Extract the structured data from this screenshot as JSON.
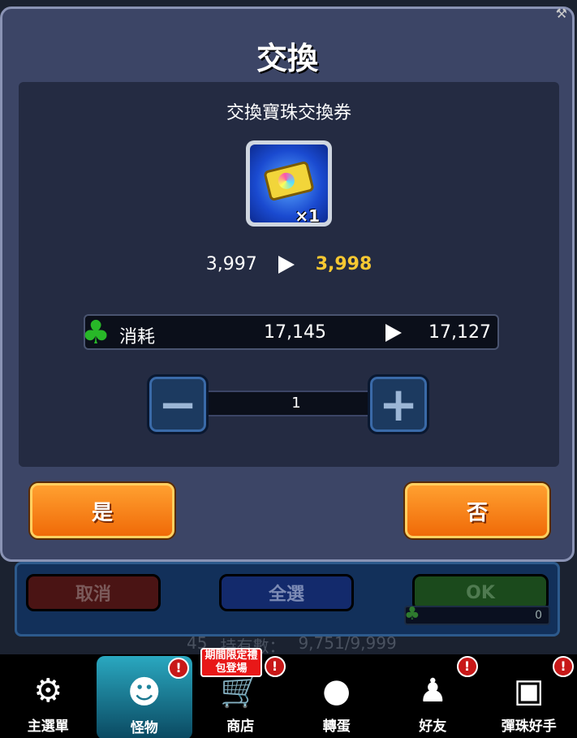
{
  "modal": {
    "title": "交換",
    "subtitle": "交換寶珠交換券",
    "item": {
      "icon": "ticket-icon",
      "quantity": "×1"
    },
    "orbs": {
      "current": "3,997",
      "after": "3,998"
    },
    "cost": {
      "icon": "clover-icon",
      "label": "消耗",
      "current": "17,145",
      "after": "17,127"
    },
    "stepper": {
      "value": "1",
      "minus_icon": "minus-icon",
      "plus_icon": "plus-icon"
    },
    "buttons": {
      "yes": "是",
      "no": "否"
    }
  },
  "background": {
    "cancel": "取消",
    "select_all": "全選",
    "ok": "OK",
    "counter": "0",
    "row_number": "45",
    "owned_label": "持有數：",
    "owned_value": "9,751/9,999"
  },
  "nav": {
    "items": [
      {
        "label": "主選單",
        "icon": "main-menu-icon"
      },
      {
        "label": "怪物",
        "icon": "monster-icon",
        "active": true,
        "badge": "!"
      },
      {
        "label": "商店",
        "icon": "cart-icon",
        "badge": "!",
        "promo": "期間限定禮包登場"
      },
      {
        "label": "轉蛋",
        "icon": "egg-icon"
      },
      {
        "label": "好友",
        "icon": "friends-icon",
        "badge": "!"
      },
      {
        "label": "彈珠好手",
        "icon": "player-card-icon",
        "badge": "!"
      }
    ]
  },
  "colors": {
    "accent_orange": "#f06a08",
    "orb_gold": "#f7c832",
    "clover_green": "#28b828"
  }
}
